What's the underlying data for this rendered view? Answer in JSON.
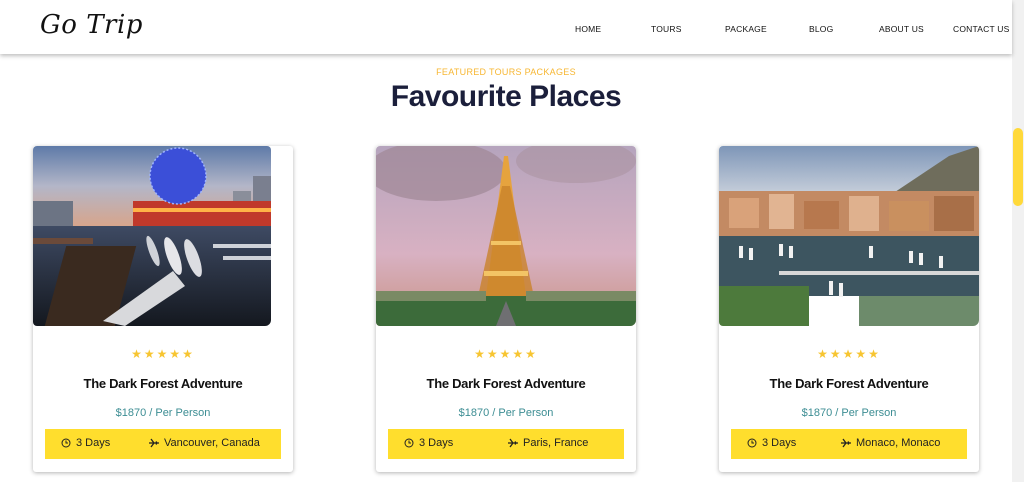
{
  "header": {
    "logo": "Go Trip",
    "nav": [
      {
        "label": "HOME"
      },
      {
        "label": "TOURS"
      },
      {
        "label": "PACKAGE"
      },
      {
        "label": "BLOG"
      },
      {
        "label": "ABOUT US"
      },
      {
        "label": "CONTACT US"
      }
    ]
  },
  "section": {
    "eyebrow": "FEATURED TOURS PACKAGES",
    "title": "Favourite Places"
  },
  "cards": [
    {
      "image_icon": "vancouver-science-world-photo",
      "stars": "★★★★★",
      "title": "The Dark Forest Adventure",
      "price": "$1870 / Per Person",
      "days": "3 Days",
      "place": "Vancouver, Canada"
    },
    {
      "image_icon": "eiffel-tower-photo",
      "stars": "★★★★★",
      "title": "The Dark Forest Adventure",
      "price": "$1870 / Per Person",
      "days": "3 Days",
      "place": "Paris, France"
    },
    {
      "image_icon": "monaco-harbor-photo",
      "stars": "★★★★★",
      "title": "The Dark Forest Adventure",
      "price": "$1870 / Per Person",
      "days": "3 Days",
      "place": "Monaco, Monaco"
    }
  ],
  "colors": {
    "accent": "#ffde2d",
    "eyebrow": "#f7b733",
    "price": "#3c8d93",
    "heading": "#1b1f3b",
    "star": "#f7c531"
  }
}
